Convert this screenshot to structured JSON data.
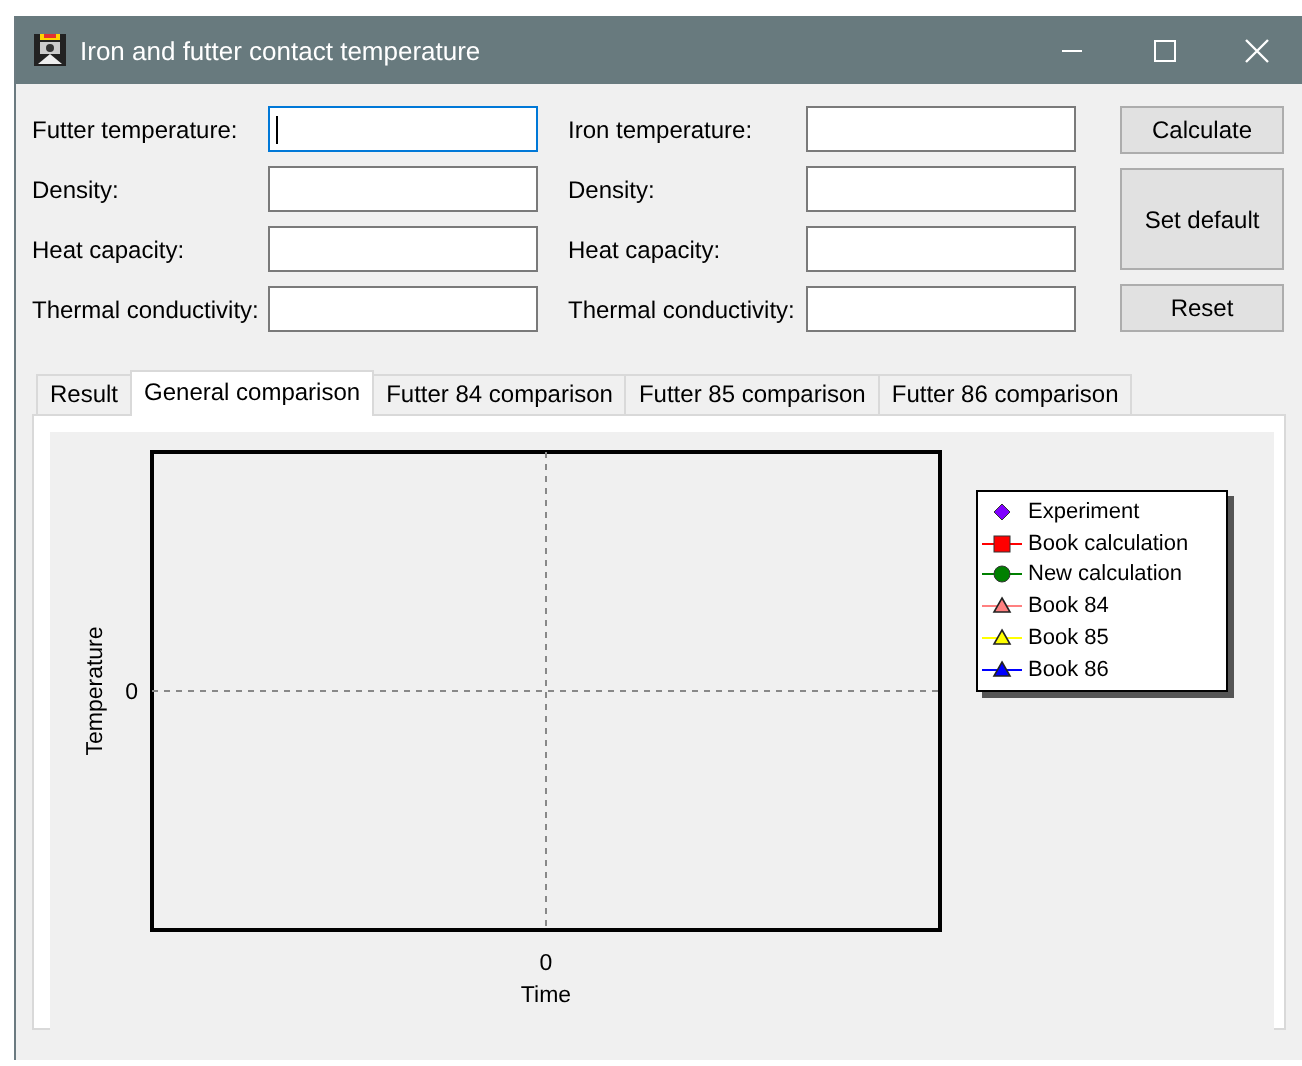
{
  "window": {
    "title": "Iron and futter contact temperature"
  },
  "futter_fields": [
    {
      "label": "Futter temperature:",
      "focused": true
    },
    {
      "label": "Density:",
      "focused": false
    },
    {
      "label": "Heat capacity:",
      "focused": false
    },
    {
      "label": "Thermal conductivity:",
      "focused": false
    }
  ],
  "iron_fields": [
    {
      "label": "Iron temperature:",
      "focused": false
    },
    {
      "label": "Density:",
      "focused": false
    },
    {
      "label": "Heat capacity:",
      "focused": false
    },
    {
      "label": "Thermal conductivity:",
      "focused": false
    }
  ],
  "buttons": [
    {
      "label": "Calculate",
      "kind": "short"
    },
    {
      "label": "Set default",
      "kind": "tall"
    },
    {
      "label": "Reset",
      "kind": "short"
    }
  ],
  "tabs": [
    {
      "label": "Result",
      "selected": false
    },
    {
      "label": "General comparison",
      "selected": true
    },
    {
      "label": "Futter 84 comparison",
      "selected": false
    },
    {
      "label": "Futter 85 comparison",
      "selected": false
    },
    {
      "label": "Futter 86 comparison",
      "selected": false
    }
  ],
  "chart": {
    "xlabel": "Time",
    "ylabel": "Temperature",
    "x_tick_label": "0",
    "y_tick_label": "0",
    "legend": [
      {
        "name": "Experiment",
        "color": "#7f00ff",
        "kind": "diamond"
      },
      {
        "name": "Book calculation",
        "color": "#ff0000",
        "kind": "square"
      },
      {
        "name": "New calculation",
        "color": "#008000",
        "kind": "circle"
      },
      {
        "name": "Book 84",
        "color": "#ff8080",
        "kind": "triangle"
      },
      {
        "name": "Book 85",
        "color": "#ffff00",
        "kind": "triangle"
      },
      {
        "name": "Book 86",
        "color": "#0000ff",
        "kind": "triangle"
      }
    ]
  }
}
